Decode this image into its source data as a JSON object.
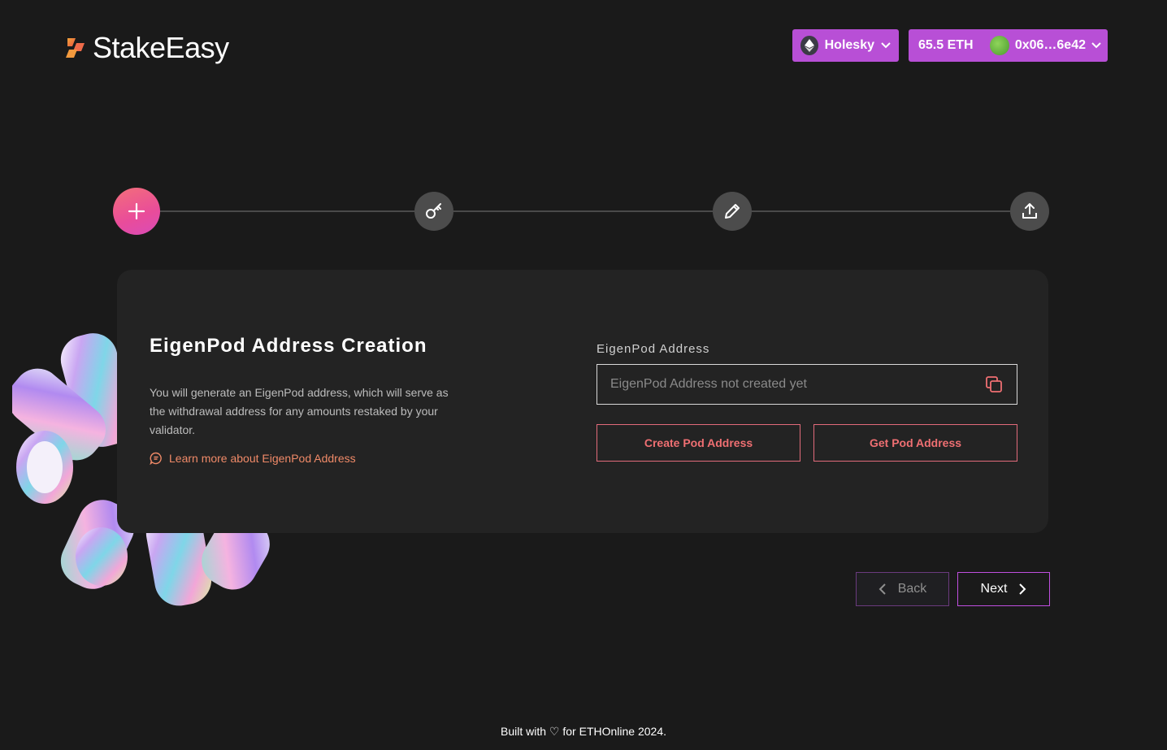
{
  "header": {
    "brand": "StakeEasy",
    "network_label": "Holesky",
    "balance": "65.5 ETH",
    "address": "0x06…6e42"
  },
  "stepper": {
    "steps": [
      "create-pod",
      "key",
      "sign",
      "upload"
    ],
    "active_step": 1
  },
  "card": {
    "title": "EigenPod Address Creation",
    "description": "You will generate an EigenPod address, which will serve as the withdrawal address for any amounts restaked by your validator.",
    "learn_more": "Learn more about EigenPod Address",
    "field_label": "EigenPod Address",
    "field_placeholder": "EigenPod Address not created yet",
    "field_value": "",
    "create_button": "Create Pod Address",
    "get_button": "Get Pod Address"
  },
  "nav": {
    "back_label": "Back",
    "next_label": "Next"
  },
  "footer": {
    "prefix": "Built with",
    "suffix": "for ETHOnline 2024."
  },
  "colors": {
    "background": "#1a1a1a",
    "card": "#232323",
    "accent_purple": "#b84fd6",
    "accent_coral": "#ef6f72",
    "active_step_gradient": [
      "#f36f7a",
      "#d94bb8"
    ]
  }
}
